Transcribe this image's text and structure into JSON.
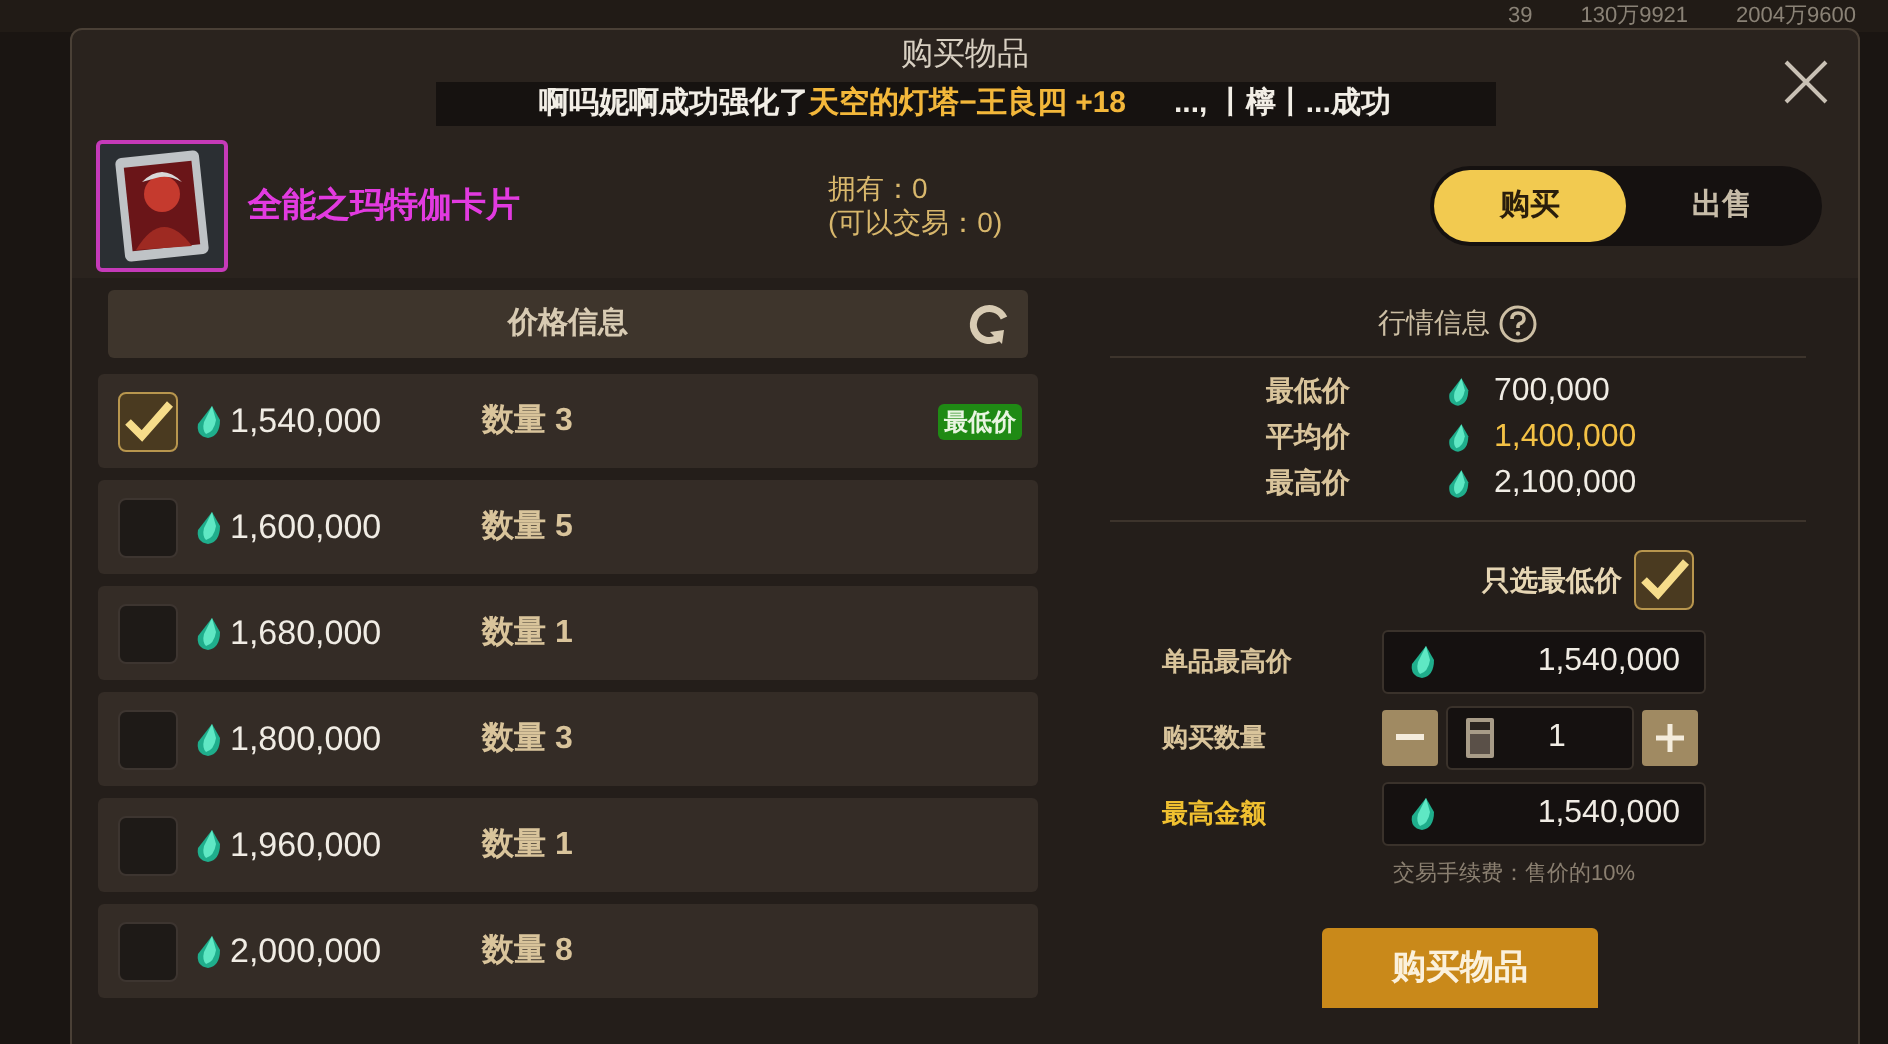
{
  "hud": {
    "counters": [
      {
        "value": "39"
      },
      {
        "value": "130万9921"
      },
      {
        "value": "2004万9600"
      }
    ]
  },
  "dialog": {
    "title": "购买物品"
  },
  "notice": [
    {
      "text": "啊吗妮啊成功强化了",
      "highlight": false
    },
    {
      "text": "天空的灯塔−王良四 +18",
      "highlight": true
    },
    {
      "text": "..., 丨檸丨...成功",
      "highlight": false
    }
  ],
  "item": {
    "name": "全能之玛特伽卡片",
    "owned": "拥有：0",
    "tradable": "(可以交易：0)"
  },
  "mode_tabs": [
    {
      "label": "购买",
      "selected": true
    },
    {
      "label": "出售",
      "selected": false
    }
  ],
  "price_list": {
    "title": "价格信息",
    "rows": [
      {
        "price": "1,540,000",
        "quantity": "数量 3",
        "checked": true,
        "badge": "最低价"
      },
      {
        "price": "1,600,000",
        "quantity": "数量 5",
        "checked": false
      },
      {
        "price": "1,680,000",
        "quantity": "数量 1",
        "checked": false
      },
      {
        "price": "1,800,000",
        "quantity": "数量 3",
        "checked": false
      },
      {
        "price": "1,960,000",
        "quantity": "数量 1",
        "checked": false
      },
      {
        "price": "2,000,000",
        "quantity": "数量 8",
        "checked": false
      }
    ]
  },
  "market": {
    "title": "行情信息",
    "stats": [
      {
        "label": "最低价",
        "value": "700,000",
        "highlight": false
      },
      {
        "label": "平均价",
        "value": "1,400,000",
        "highlight": true
      },
      {
        "label": "最高价",
        "value": "2,100,000",
        "highlight": false
      }
    ]
  },
  "lowest_only": {
    "label": "只选最低价",
    "checked": true
  },
  "max_unit_price": {
    "label": "单品最高价",
    "value": "1,540,000"
  },
  "quantity": {
    "label": "购买数量",
    "value": "1"
  },
  "max_total": {
    "label": "最高金额",
    "value": "1,540,000"
  },
  "fee_note": "交易手续费：售价的10%",
  "buy_button": "购买物品"
}
